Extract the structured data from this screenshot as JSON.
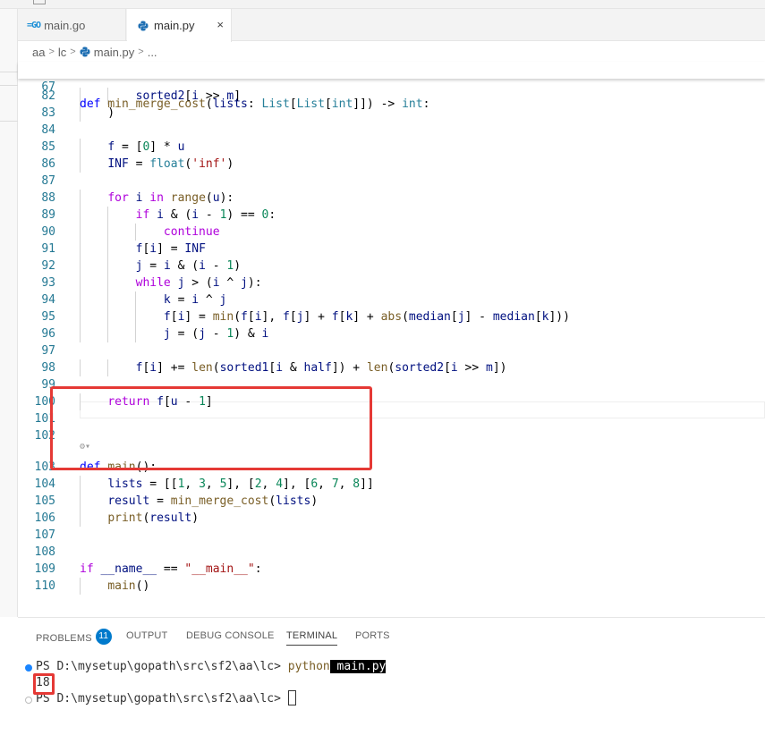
{
  "tabs": [
    {
      "label": "main.go",
      "icon": "go-file-icon",
      "active": false
    },
    {
      "label": "main.py",
      "icon": "python-file-icon",
      "active": true,
      "close": "×"
    }
  ],
  "breadcrumb": [
    "aa",
    "lc",
    "main.py",
    "..."
  ],
  "sticky_line": {
    "number": "67",
    "code": [
      [
        "kw",
        "def"
      ],
      [
        "op",
        " "
      ],
      [
        "fn",
        "min_merge_cost"
      ],
      [
        "op",
        "("
      ],
      [
        "vr",
        "lists"
      ],
      [
        "op",
        ": "
      ],
      [
        "ty",
        "List"
      ],
      [
        "op",
        "["
      ],
      [
        "ty",
        "List"
      ],
      [
        "op",
        "["
      ],
      [
        "ty",
        "int"
      ],
      [
        "op",
        "]]) -> "
      ],
      [
        "ty",
        "int"
      ],
      [
        "op",
        ":"
      ]
    ]
  },
  "lines": [
    {
      "n": "82",
      "code": [
        [
          "op",
          "        "
        ],
        [
          "vr",
          "sorted2"
        ],
        [
          "op",
          "["
        ],
        [
          "vr",
          "i"
        ],
        [
          "op",
          " >> "
        ],
        [
          "vr",
          "m"
        ],
        [
          "op",
          "]"
        ]
      ]
    },
    {
      "n": "83",
      "code": [
        [
          "op",
          "    )"
        ]
      ]
    },
    {
      "n": "84",
      "code": []
    },
    {
      "n": "85",
      "code": [
        [
          "op",
          "    "
        ],
        [
          "vr",
          "f"
        ],
        [
          "op",
          " = ["
        ],
        [
          "num",
          "0"
        ],
        [
          "op",
          "] * "
        ],
        [
          "vr",
          "u"
        ]
      ]
    },
    {
      "n": "86",
      "code": [
        [
          "op",
          "    "
        ],
        [
          "vr",
          "INF"
        ],
        [
          "op",
          " = "
        ],
        [
          "ty",
          "float"
        ],
        [
          "op",
          "("
        ],
        [
          "str",
          "'inf'"
        ],
        [
          "op",
          ")"
        ]
      ]
    },
    {
      "n": "87",
      "code": []
    },
    {
      "n": "88",
      "code": [
        [
          "op",
          "    "
        ],
        [
          "ctl",
          "for"
        ],
        [
          "op",
          " "
        ],
        [
          "vr",
          "i"
        ],
        [
          "op",
          " "
        ],
        [
          "ctl",
          "in"
        ],
        [
          "op",
          " "
        ],
        [
          "fn",
          "range"
        ],
        [
          "op",
          "("
        ],
        [
          "vr",
          "u"
        ],
        [
          "op",
          "):"
        ]
      ]
    },
    {
      "n": "89",
      "code": [
        [
          "op",
          "        "
        ],
        [
          "ctl",
          "if"
        ],
        [
          "op",
          " "
        ],
        [
          "vr",
          "i"
        ],
        [
          "op",
          " & ("
        ],
        [
          "vr",
          "i"
        ],
        [
          "op",
          " - "
        ],
        [
          "num",
          "1"
        ],
        [
          "op",
          ") == "
        ],
        [
          "num",
          "0"
        ],
        [
          "op",
          ":"
        ]
      ]
    },
    {
      "n": "90",
      "code": [
        [
          "op",
          "            "
        ],
        [
          "ctl",
          "continue"
        ]
      ]
    },
    {
      "n": "91",
      "code": [
        [
          "op",
          "        "
        ],
        [
          "vr",
          "f"
        ],
        [
          "op",
          "["
        ],
        [
          "vr",
          "i"
        ],
        [
          "op",
          "] = "
        ],
        [
          "vr",
          "INF"
        ]
      ]
    },
    {
      "n": "92",
      "code": [
        [
          "op",
          "        "
        ],
        [
          "vr",
          "j"
        ],
        [
          "op",
          " = "
        ],
        [
          "vr",
          "i"
        ],
        [
          "op",
          " & ("
        ],
        [
          "vr",
          "i"
        ],
        [
          "op",
          " - "
        ],
        [
          "num",
          "1"
        ],
        [
          "op",
          ")"
        ]
      ]
    },
    {
      "n": "93",
      "code": [
        [
          "op",
          "        "
        ],
        [
          "ctl",
          "while"
        ],
        [
          "op",
          " "
        ],
        [
          "vr",
          "j"
        ],
        [
          "op",
          " > ("
        ],
        [
          "vr",
          "i"
        ],
        [
          "op",
          " ^ "
        ],
        [
          "vr",
          "j"
        ],
        [
          "op",
          "):"
        ]
      ]
    },
    {
      "n": "94",
      "code": [
        [
          "op",
          "            "
        ],
        [
          "vr",
          "k"
        ],
        [
          "op",
          " = "
        ],
        [
          "vr",
          "i"
        ],
        [
          "op",
          " ^ "
        ],
        [
          "vr",
          "j"
        ]
      ]
    },
    {
      "n": "95",
      "code": [
        [
          "op",
          "            "
        ],
        [
          "vr",
          "f"
        ],
        [
          "op",
          "["
        ],
        [
          "vr",
          "i"
        ],
        [
          "op",
          "] = "
        ],
        [
          "fn",
          "min"
        ],
        [
          "op",
          "("
        ],
        [
          "vr",
          "f"
        ],
        [
          "op",
          "["
        ],
        [
          "vr",
          "i"
        ],
        [
          "op",
          "], "
        ],
        [
          "vr",
          "f"
        ],
        [
          "op",
          "["
        ],
        [
          "vr",
          "j"
        ],
        [
          "op",
          "] + "
        ],
        [
          "vr",
          "f"
        ],
        [
          "op",
          "["
        ],
        [
          "vr",
          "k"
        ],
        [
          "op",
          "] + "
        ],
        [
          "fn",
          "abs"
        ],
        [
          "op",
          "("
        ],
        [
          "vr",
          "median"
        ],
        [
          "op",
          "["
        ],
        [
          "vr",
          "j"
        ],
        [
          "op",
          "] - "
        ],
        [
          "vr",
          "median"
        ],
        [
          "op",
          "["
        ],
        [
          "vr",
          "k"
        ],
        [
          "op",
          "]))"
        ]
      ]
    },
    {
      "n": "96",
      "code": [
        [
          "op",
          "            "
        ],
        [
          "vr",
          "j"
        ],
        [
          "op",
          " = ("
        ],
        [
          "vr",
          "j"
        ],
        [
          "op",
          " - "
        ],
        [
          "num",
          "1"
        ],
        [
          "op",
          ") & "
        ],
        [
          "vr",
          "i"
        ]
      ]
    },
    {
      "n": "97",
      "code": []
    },
    {
      "n": "98",
      "code": [
        [
          "op",
          "        "
        ],
        [
          "vr",
          "f"
        ],
        [
          "op",
          "["
        ],
        [
          "vr",
          "i"
        ],
        [
          "op",
          "] += "
        ],
        [
          "fn",
          "len"
        ],
        [
          "op",
          "("
        ],
        [
          "vr",
          "sorted1"
        ],
        [
          "op",
          "["
        ],
        [
          "vr",
          "i"
        ],
        [
          "op",
          " & "
        ],
        [
          "vr",
          "half"
        ],
        [
          "op",
          "]) + "
        ],
        [
          "fn",
          "len"
        ],
        [
          "op",
          "("
        ],
        [
          "vr",
          "sorted2"
        ],
        [
          "op",
          "["
        ],
        [
          "vr",
          "i"
        ],
        [
          "op",
          " >> "
        ],
        [
          "vr",
          "m"
        ],
        [
          "op",
          "])"
        ]
      ]
    },
    {
      "n": "99",
      "code": []
    },
    {
      "n": "100",
      "code": [
        [
          "op",
          "    "
        ],
        [
          "ctl",
          "return"
        ],
        [
          "op",
          " "
        ],
        [
          "vr",
          "f"
        ],
        [
          "op",
          "["
        ],
        [
          "vr",
          "u"
        ],
        [
          "op",
          " - "
        ],
        [
          "num",
          "1"
        ],
        [
          "op",
          "]"
        ]
      ]
    },
    {
      "n": "101",
      "code": []
    },
    {
      "n": "102",
      "code": []
    },
    {
      "n": "103",
      "code": [
        [
          "kw",
          "def"
        ],
        [
          "op",
          " "
        ],
        [
          "fn",
          "main"
        ],
        [
          "op",
          "():"
        ]
      ]
    },
    {
      "n": "104",
      "code": [
        [
          "op",
          "    "
        ],
        [
          "vr",
          "lists"
        ],
        [
          "op",
          " = [["
        ],
        [
          "num",
          "1"
        ],
        [
          "op",
          ", "
        ],
        [
          "num",
          "3"
        ],
        [
          "op",
          ", "
        ],
        [
          "num",
          "5"
        ],
        [
          "op",
          "], ["
        ],
        [
          "num",
          "2"
        ],
        [
          "op",
          ", "
        ],
        [
          "num",
          "4"
        ],
        [
          "op",
          "], ["
        ],
        [
          "num",
          "6"
        ],
        [
          "op",
          ", "
        ],
        [
          "num",
          "7"
        ],
        [
          "op",
          ", "
        ],
        [
          "num",
          "8"
        ],
        [
          "op",
          "]]"
        ]
      ]
    },
    {
      "n": "105",
      "code": [
        [
          "op",
          "    "
        ],
        [
          "vr",
          "result"
        ],
        [
          "op",
          " = "
        ],
        [
          "fn",
          "min_merge_cost"
        ],
        [
          "op",
          "("
        ],
        [
          "vr",
          "lists"
        ],
        [
          "op",
          ")"
        ]
      ]
    },
    {
      "n": "106",
      "code": [
        [
          "op",
          "    "
        ],
        [
          "fn",
          "print"
        ],
        [
          "op",
          "("
        ],
        [
          "vr",
          "result"
        ],
        [
          "op",
          ")"
        ]
      ]
    },
    {
      "n": "107",
      "code": []
    },
    {
      "n": "108",
      "code": []
    },
    {
      "n": "109",
      "code": [
        [
          "ctl",
          "if"
        ],
        [
          "op",
          " "
        ],
        [
          "vr",
          "__name__"
        ],
        [
          "op",
          " == "
        ],
        [
          "str",
          "\"__main__\""
        ],
        [
          "op",
          ":"
        ]
      ]
    },
    {
      "n": "110",
      "code": [
        [
          "op",
          "    "
        ],
        [
          "fn",
          "main"
        ],
        [
          "op",
          "()"
        ]
      ]
    }
  ],
  "panel": {
    "tabs": [
      "PROBLEMS",
      "OUTPUT",
      "DEBUG CONSOLE",
      "TERMINAL",
      "PORTS"
    ],
    "active_tab": "TERMINAL",
    "problems_count": "11"
  },
  "terminal": {
    "prompt1": "PS D:\\mysetup\\gopath\\src\\sf2\\aa\\lc> ",
    "command": "python",
    "command_arg": " main.py",
    "output": "18",
    "prompt2": "PS D:\\mysetup\\gopath\\src\\sf2\\aa\\lc> "
  },
  "colors": {
    "highlight_box": "#e53935",
    "line_number": "#237893",
    "keyword": "#0000ff",
    "control": "#af00db",
    "function": "#795e26",
    "type": "#267f99",
    "number": "#098658",
    "string": "#a31515",
    "variable": "#001080",
    "badge": "#007acc"
  }
}
